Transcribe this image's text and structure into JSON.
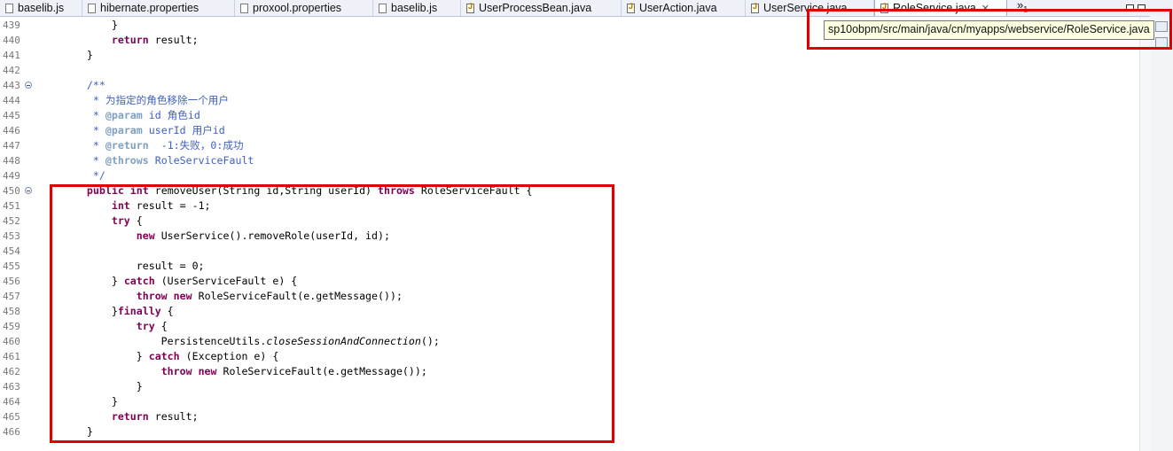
{
  "tabs": [
    {
      "label": "baselib.js",
      "type": "js"
    },
    {
      "label": "hibernate.properties",
      "type": "props"
    },
    {
      "label": "proxool.properties",
      "type": "props"
    },
    {
      "label": "baselib.js",
      "type": "js"
    },
    {
      "label": "UserProcessBean.java",
      "type": "java"
    },
    {
      "label": "UserAction.java",
      "type": "java"
    },
    {
      "label": "UserService.java",
      "type": "java"
    },
    {
      "label": "RoleService.java",
      "type": "java",
      "active": true
    }
  ],
  "tab_close_glyph": "✕",
  "overflow": {
    "glyph": "»",
    "count": "1"
  },
  "tooltip": {
    "text": "sp10obpm/src/main/java/cn/myapps/webservice/RoleService.java"
  },
  "editor": {
    "line_numbers": [
      "439",
      "440",
      "441",
      "442",
      "443",
      "444",
      "445",
      "446",
      "447",
      "448",
      "449",
      "450",
      "451",
      "452",
      "453",
      "454",
      "455",
      "456",
      "457",
      "458",
      "459",
      "460",
      "461",
      "462",
      "463",
      "464",
      "465",
      "466"
    ],
    "fold_lines": [
      "443",
      "450"
    ],
    "lines": [
      "        }",
      "        return result;",
      "    }",
      "",
      "    /**",
      "     * 为指定的角色移除一个用户",
      "     * @param id 角色id",
      "     * @param userId 用户id",
      "     * @return  -1:失败，0:成功",
      "     * @throws RoleServiceFault",
      "     */",
      "    public int removeUser(String id,String userId) throws RoleServiceFault {",
      "        int result = -1;",
      "        try {",
      "            new UserService().removeRole(userId, id);",
      "",
      "            result = 0;",
      "        } catch (UserServiceFault e) {",
      "            throw new RoleServiceFault(e.getMessage());",
      "        }finally {",
      "            try {",
      "                PersistenceUtils.closeSessionAndConnection();",
      "            } catch (Exception e) {",
      "                throw new RoleServiceFault(e.getMessage());",
      "            }",
      "        }",
      "        return result;",
      "    }"
    ]
  },
  "colors": {
    "highlight": "#e00000",
    "keyword": "#7f0055",
    "comment": "#3f5fbf",
    "javadoc_tag": "#7f9fbf"
  }
}
